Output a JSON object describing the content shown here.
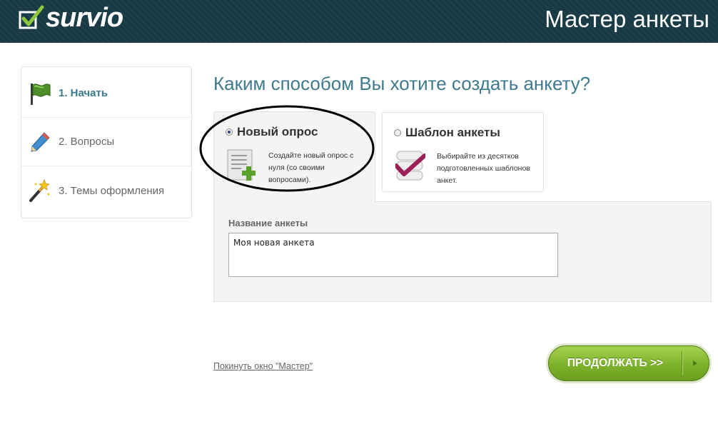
{
  "header": {
    "logo_text": "survio",
    "title": "Мастер анкеты"
  },
  "sidebar": {
    "steps": [
      {
        "label": "1. Начать",
        "icon": "flag-icon",
        "active": true
      },
      {
        "label": "2. Вопросы",
        "icon": "pencil-icon",
        "active": false
      },
      {
        "label": "3. Темы оформления",
        "icon": "magic-wand-icon",
        "active": false
      }
    ]
  },
  "main": {
    "title": "Каким способом Вы хотите создать анкету?",
    "options": [
      {
        "title": "Новый опрос",
        "description": "Создайте новый опрос с нуля (со своими вопросами).",
        "icon": "new-document-icon",
        "selected": true
      },
      {
        "title": "Шаблон анкеты",
        "description": "Выбирайте из десятков подготовленных шаблонов анкет.",
        "icon": "template-check-icon",
        "selected": false
      }
    ],
    "name_field": {
      "label": "Название анкеты",
      "value": "Моя новая анкета"
    }
  },
  "footer": {
    "leave_link": "Покинуть окно \"Мастер\"",
    "continue_button": "ПРОДОЛЖАТЬ >>"
  },
  "colors": {
    "header_bg": "#183a45",
    "title_color": "#3f7a8d",
    "button_green": "#7eb22b",
    "template_check": "#9c1f55"
  }
}
